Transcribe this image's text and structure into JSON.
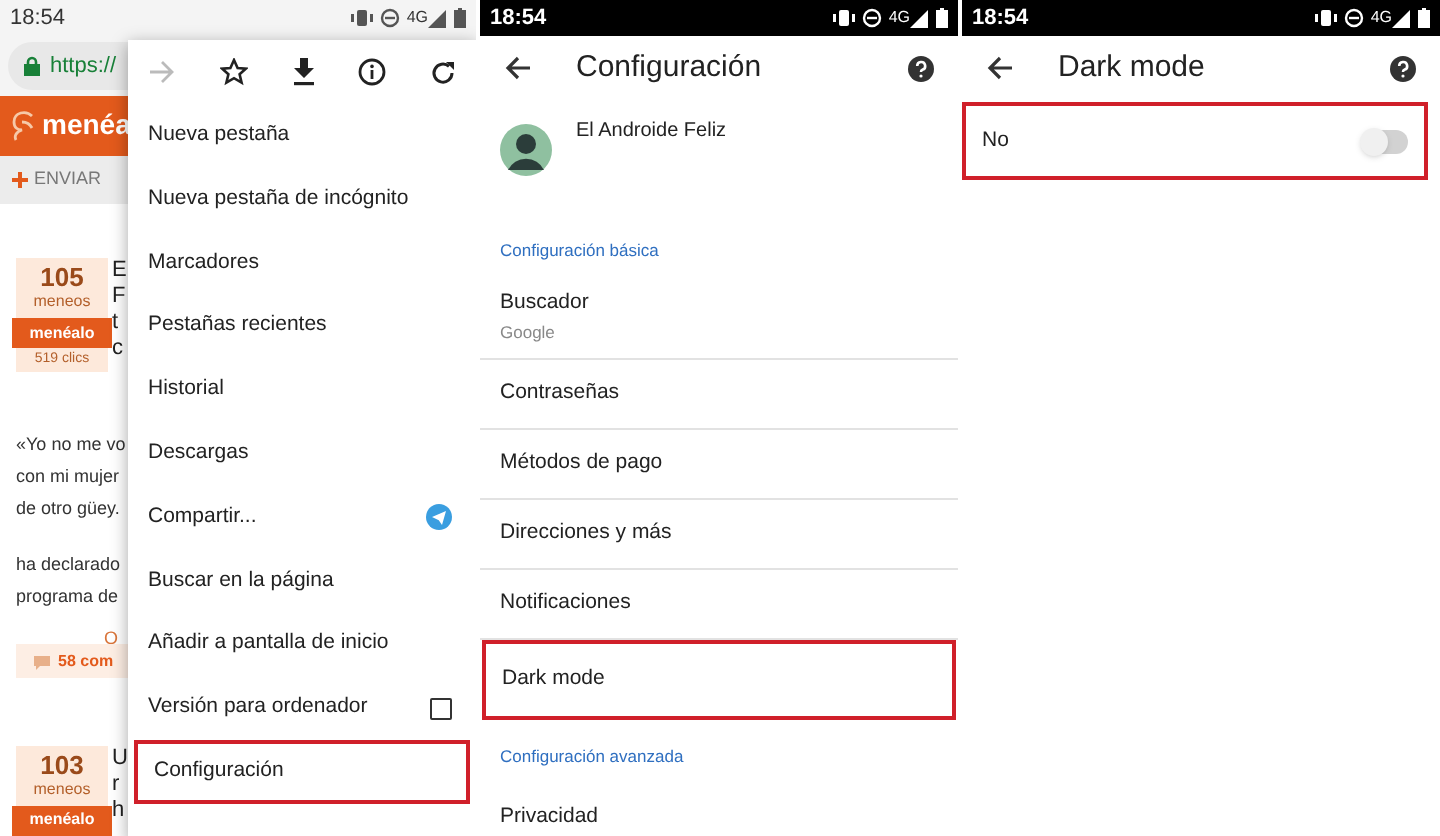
{
  "browser_screen": {
    "status_bar": {
      "time": "18:54",
      "network": "4G"
    },
    "url": "https://",
    "logo": "menéa",
    "send_button": "ENVIAR",
    "stories": [
      {
        "votes": "105",
        "votes_label": "meneos",
        "vote_button": "menéalo",
        "clicks": "519 clics",
        "title_lines": [
          "E",
          "F",
          "t",
          "c"
        ]
      },
      {
        "votes": "103",
        "votes_label": "meneos",
        "vote_button": "menéalo",
        "title_lines": [
          "U",
          "r",
          "h"
        ]
      }
    ],
    "quote_lines": [
      "«Yo no me vo",
      "con mi mujer",
      "de otro güey."
    ],
    "body_lines": [
      "ha declarado",
      "programa de"
    ],
    "source_fragment": "O",
    "comments": "58 com",
    "menu": {
      "items": [
        {
          "kind": "item",
          "label": "Nueva pestaña",
          "highlighted": false
        },
        {
          "kind": "item",
          "label": "Nueva pestaña de incógnito",
          "highlighted": false
        },
        {
          "kind": "item",
          "label": "Marcadores",
          "highlighted": false
        },
        {
          "kind": "item",
          "label": "Pestañas recientes",
          "highlighted": false
        },
        {
          "kind": "item",
          "label": "Historial",
          "highlighted": false
        },
        {
          "kind": "item",
          "label": "Descargas",
          "highlighted": false
        },
        {
          "kind": "share",
          "label": "Compartir...",
          "highlighted": false
        },
        {
          "kind": "item",
          "label": "Buscar en la página",
          "highlighted": false
        },
        {
          "kind": "item",
          "label": "Añadir a pantalla de inicio",
          "highlighted": false
        },
        {
          "kind": "checkbox",
          "label": "Versión para ordenador",
          "checked": false,
          "highlighted": false
        },
        {
          "kind": "item",
          "label": "Configuración",
          "highlighted": true
        }
      ]
    }
  },
  "settings_screen": {
    "status_bar": {
      "time": "18:54",
      "network": "4G"
    },
    "title": "Configuración",
    "account": "El Androide Feliz",
    "sections": [
      {
        "header": "Configuración básica",
        "items": [
          {
            "label": "Buscador",
            "value": "Google",
            "highlighted": false
          },
          {
            "label": "Contraseñas",
            "highlighted": false
          },
          {
            "label": "Métodos de pago",
            "highlighted": false
          },
          {
            "label": "Direcciones y más",
            "highlighted": false
          },
          {
            "label": "Notificaciones",
            "highlighted": false
          },
          {
            "label": "Dark mode",
            "highlighted": true
          }
        ]
      },
      {
        "header": "Configuración avanzada",
        "items": [
          {
            "label": "Privacidad",
            "highlighted": false
          }
        ]
      }
    ]
  },
  "dark_mode_screen": {
    "status_bar": {
      "time": "18:54",
      "network": "4G"
    },
    "title": "Dark mode",
    "setting": {
      "label": "No",
      "on": false,
      "highlighted": true
    }
  }
}
